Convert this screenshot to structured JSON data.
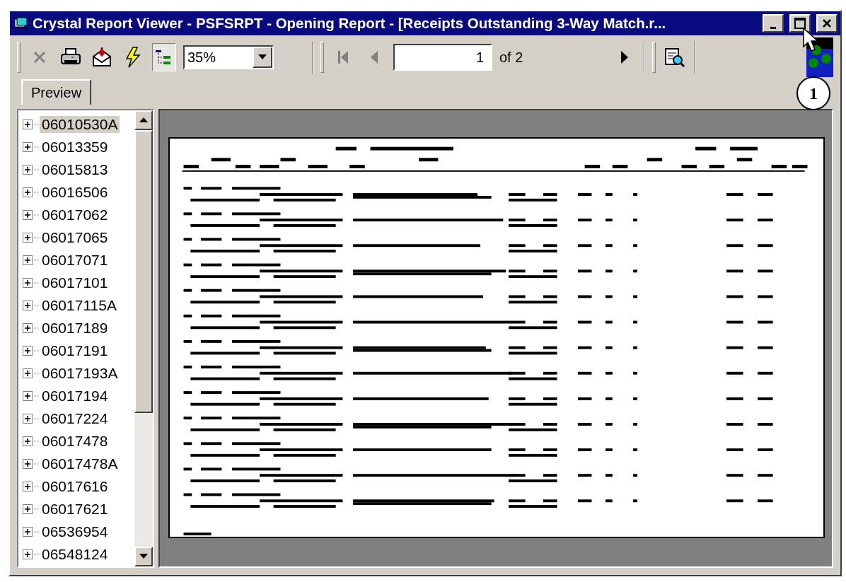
{
  "window": {
    "title": "Crystal Report Viewer - PSFSRPT - Opening Report - [Receipts Outstanding 3-Way Match.r..."
  },
  "toolbar": {
    "zoom": "35%",
    "page": "1",
    "page_count": "of 2"
  },
  "tabs": [
    {
      "label": "Preview",
      "selected": true
    }
  ],
  "tree": {
    "items": [
      {
        "label": "06010530A",
        "selected": true
      },
      {
        "label": "06013359",
        "selected": false
      },
      {
        "label": "06015813",
        "selected": false
      },
      {
        "label": "06016506",
        "selected": false
      },
      {
        "label": "06017062",
        "selected": false
      },
      {
        "label": "06017065",
        "selected": false
      },
      {
        "label": "06017071",
        "selected": false
      },
      {
        "label": "06017101",
        "selected": false
      },
      {
        "label": "06017115A",
        "selected": false
      },
      {
        "label": "06017189",
        "selected": false
      },
      {
        "label": "06017191",
        "selected": false
      },
      {
        "label": "06017193A",
        "selected": false
      },
      {
        "label": "06017194",
        "selected": false
      },
      {
        "label": "06017224",
        "selected": false
      },
      {
        "label": "06017478",
        "selected": false
      },
      {
        "label": "06017478A",
        "selected": false
      },
      {
        "label": "06017616",
        "selected": false
      },
      {
        "label": "06017621",
        "selected": false
      },
      {
        "label": "06536954",
        "selected": false
      },
      {
        "label": "06548124",
        "selected": false
      }
    ]
  },
  "callout": "1"
}
